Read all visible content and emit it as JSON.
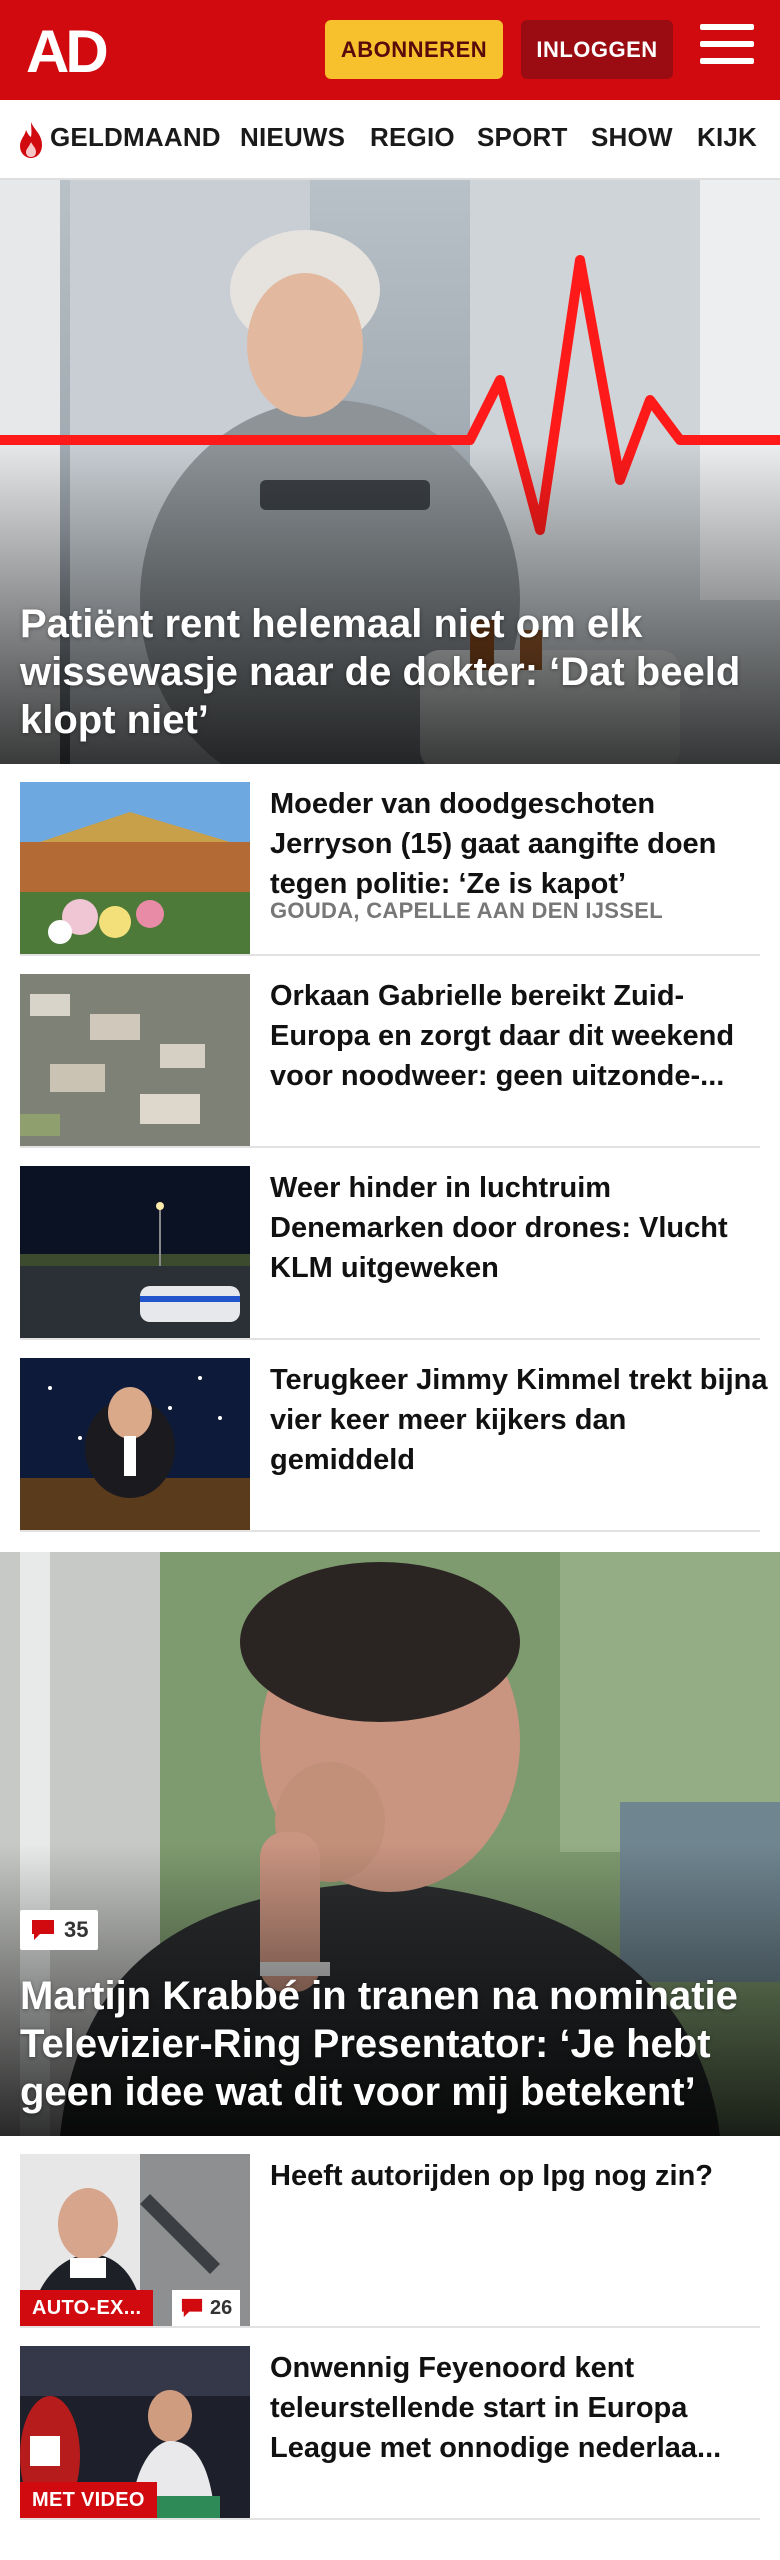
{
  "header": {
    "logo_text": "AD",
    "subscribe_label": "ABONNEREN",
    "login_label": "INLOGGEN",
    "brand_color": "#d10a10",
    "subscribe_color": "#f6c12c"
  },
  "nav": {
    "items": [
      {
        "label": "GELDMAAND",
        "icon": "flame-icon"
      },
      {
        "label": "NIEUWS"
      },
      {
        "label": "REGIO"
      },
      {
        "label": "SPORT"
      },
      {
        "label": "SHOW"
      },
      {
        "label": "KIJK"
      }
    ]
  },
  "hero": {
    "title": "Patiënt rent helemaal niet om elk wissewasje naar de dokter: ‘Dat beeld klopt niet’"
  },
  "articles": [
    {
      "title": "Moeder van doodgeschoten Jerryson (15) gaat aangifte doen tegen politie: ‘Ze is kapot’",
      "meta": "GOUDA, CAPELLE AAN DEN IJSSEL"
    },
    {
      "title": "Orkaan Gabrielle bereikt Zuid-Europa en zorgt daar dit weekend voor noodweer: geen uitzonde-..."
    },
    {
      "title": "Weer hinder in luchtruim Denemarken door drones: Vlucht KLM uitgeweken"
    },
    {
      "title": "Terugkeer Jimmy Kimmel trekt bijna vier keer meer kijkers dan gemiddeld"
    }
  ],
  "hero2": {
    "comments": "35",
    "title": "Martijn Krabbé in tranen na nominatie Televizier-Ring Presentator: ‘Je hebt geen idee wat dit voor mij betekent’"
  },
  "articles2": [
    {
      "title": "Heeft autorijden op lpg nog zin?",
      "label": "AUTO-EX...",
      "comments": "26"
    },
    {
      "title": "Onwennig Feyenoord kent teleurstellende start in Europa League met onnodige nederlaa...",
      "label": "MET VIDEO"
    }
  ]
}
